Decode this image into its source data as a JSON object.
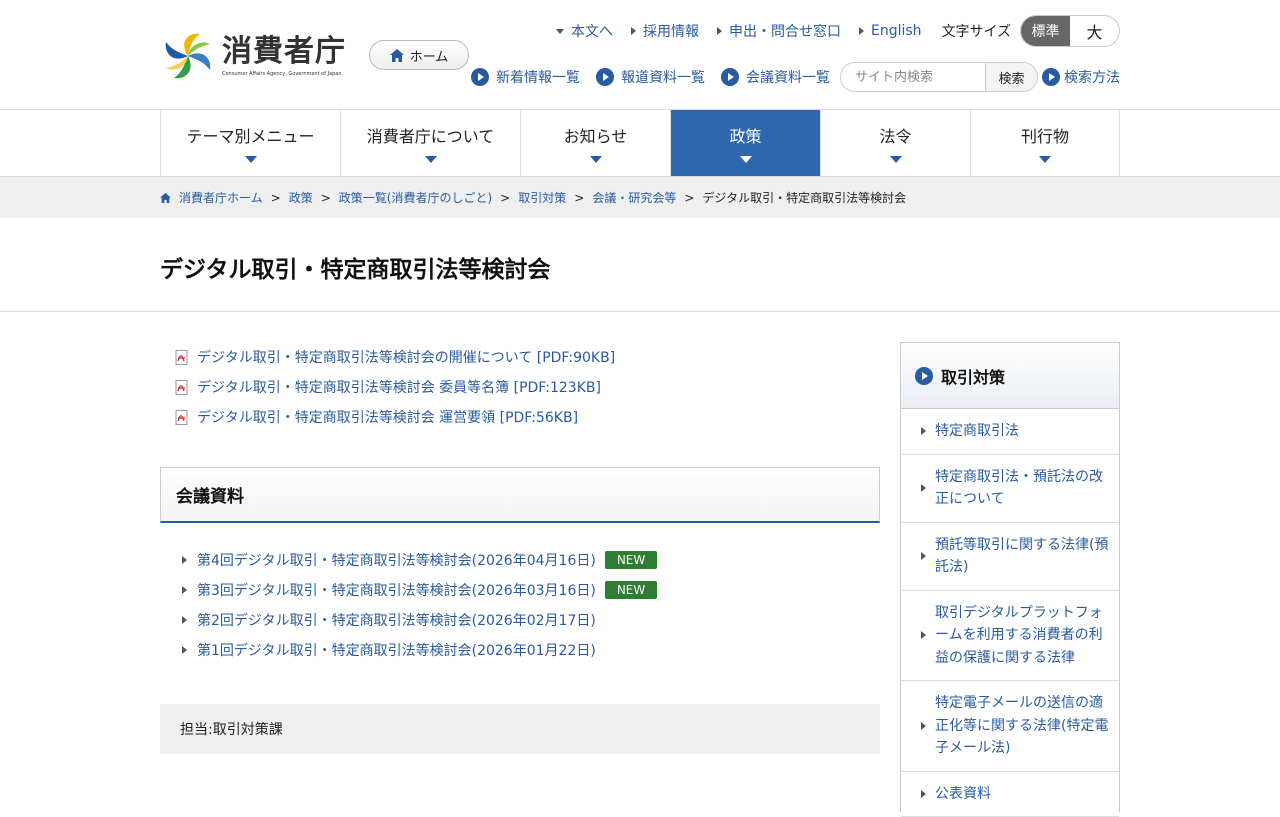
{
  "header": {
    "logo_title": "消費者庁",
    "logo_sub": "Consumer Affairs Agency, Government of Japan",
    "home_label": "ホーム",
    "util_links": [
      "本文へ",
      "採用情報",
      "申出・問合せ窓口",
      "English"
    ],
    "fontsize_label": "文字サイズ",
    "fontsize_options": {
      "standard": "標準",
      "large": "大"
    },
    "fontsize_selected": "標準",
    "nav_links": [
      "新着情報一覧",
      "報道資料一覧",
      "会議資料一覧"
    ],
    "search_placeholder": "サイト内検索",
    "search_button": "検索",
    "search_help": "検索方法"
  },
  "gnav": {
    "items": [
      "テーマ別メニュー",
      "消費者庁について",
      "お知らせ",
      "政策",
      "法令",
      "刊行物"
    ],
    "active": "政策"
  },
  "breadcrumb": {
    "items": [
      "消費者庁ホーム",
      "政策",
      "政策一覧(消費者庁のしごと)",
      "取引対策",
      "会議・研究会等"
    ],
    "current": "デジタル取引・特定商取引法等検討会",
    "separator": ">"
  },
  "page": {
    "title": "デジタル取引・特定商取引法等検討会",
    "pdf_links": [
      "デジタル取引・特定商取引法等検討会の開催について [PDF:90KB]",
      "デジタル取引・特定商取引法等検討会 委員等名簿 [PDF:123KB]",
      "デジタル取引・特定商取引法等検討会 運営要領 [PDF:56KB]"
    ],
    "section_title": "会議資料",
    "meetings": [
      {
        "label": "第4回デジタル取引・特定商取引法等検討会(2026年04月16日)",
        "badge": "NEW"
      },
      {
        "label": "第3回デジタル取引・特定商取引法等検討会(2026年03月16日)",
        "badge": "NEW"
      },
      {
        "label": "第2回デジタル取引・特定商取引法等検討会(2026年02月17日)",
        "badge": ""
      },
      {
        "label": "第1回デジタル取引・特定商取引法等検討会(2026年01月22日)",
        "badge": ""
      }
    ],
    "contact": "担当:取引対策課"
  },
  "side": {
    "title": "取引対策",
    "items": [
      "特定商取引法",
      "特定商取引法・預託法の改正について",
      "預託等取引に関する法律(預託法)",
      "取引デジタルプラットフォームを利用する消費者の利益の保護に関する法律",
      "特定電子メールの送信の適正化等に関する法律(特定電子メール法)",
      "公表資料"
    ]
  },
  "colors": {
    "accent": "#2e67ad",
    "link": "#2a5aa0",
    "new_badge": "#2e7d32"
  }
}
